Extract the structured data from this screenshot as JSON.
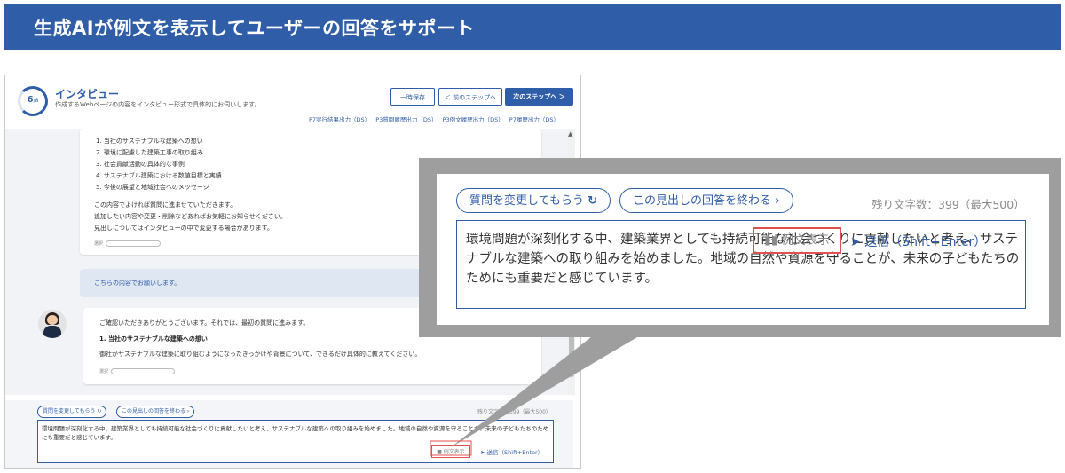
{
  "banner": {
    "title": "生成AIが例文を表示してユーザーの回答をサポート"
  },
  "app": {
    "progress": {
      "current": "6",
      "total": "/8",
      "fraction": 0.75
    },
    "title": "インタビュー",
    "subtitle": "作成するWebページの内容をインタビュー形式で具体的にお伺いします。",
    "buttons": {
      "save": "一時保存",
      "prev": "＜ 前のステップへ",
      "next": "次のステップへ ＞"
    },
    "export_links": [
      "P7実行結果出力（DS）",
      "P3質問履歴出力（DS）",
      "P3例文履歴出力（DS）",
      "P7履歴出力（DS）"
    ],
    "card1": {
      "items": [
        "1. 当社のサステナブルな建築への想い",
        "2. 環境に配慮した建築工事の取り組み",
        "3. 社会貢献活動の具体的な事例",
        "4. サステナブル建築における数値目標と実績",
        "5. 今後の展望と地域社会へのメッセージ"
      ],
      "note": [
        "この内容でよければ質問に進ませていただきます。",
        "追加したい内容や変更・削除などあればお気軽にお知らせください。",
        "見出しについてはインタビューの中で変更する場合があります。"
      ],
      "choice_label": "選択"
    },
    "reply": "こちらの内容でお願いします。",
    "card2": {
      "intro": "ご確認いただきありがとうございます。それでは、最初の質問に進みます。",
      "question_title": "1. 当社のサステナブルな建築への想い",
      "question_body": "御社がサステナブルな建築に取り組むようになったきっかけや背景について、できるだけ具体的に教えてください。",
      "choice_label": "選択"
    },
    "input": {
      "rephrase": "質問を変更してもらう ↻",
      "finish": "この見出しの回答を終わる ›",
      "remaining": "残り文字数：399（最大500）",
      "text": "環境問題が深刻化する中、建築業界としても持続可能な社会づくりに貢献したいと考え、サステナブルな建築への取り組みを始めました。地域の自然や資源を守ることが、未来の子どもたちのためにも重要だと感じています。",
      "example": "例文表示",
      "send": "送信（Shift+Enter）"
    }
  },
  "zoom": {
    "rephrase": "質問を変更してもらう",
    "finish": "この見出しの回答を終わる",
    "remaining": "残り文字数：399（最大500）",
    "text": "環境問題が深刻化する中、建築業界としても持続可能な社会づくりに貢献したいと考え、サステナブルな建築への取り組みを始めました。地域の自然や資源を守ることが、未来の子どもたちのためにも重要だと感じています。",
    "example": "例文表示",
    "send": "送信（Shift+Enter）"
  },
  "colors": {
    "brand": "#2f5da8",
    "highlight": "#e05252",
    "callout": "#9e9e9e"
  },
  "icons": [
    "refresh-icon",
    "chevron-right-icon",
    "book-icon",
    "send-icon",
    "chevron-left-icon"
  ]
}
